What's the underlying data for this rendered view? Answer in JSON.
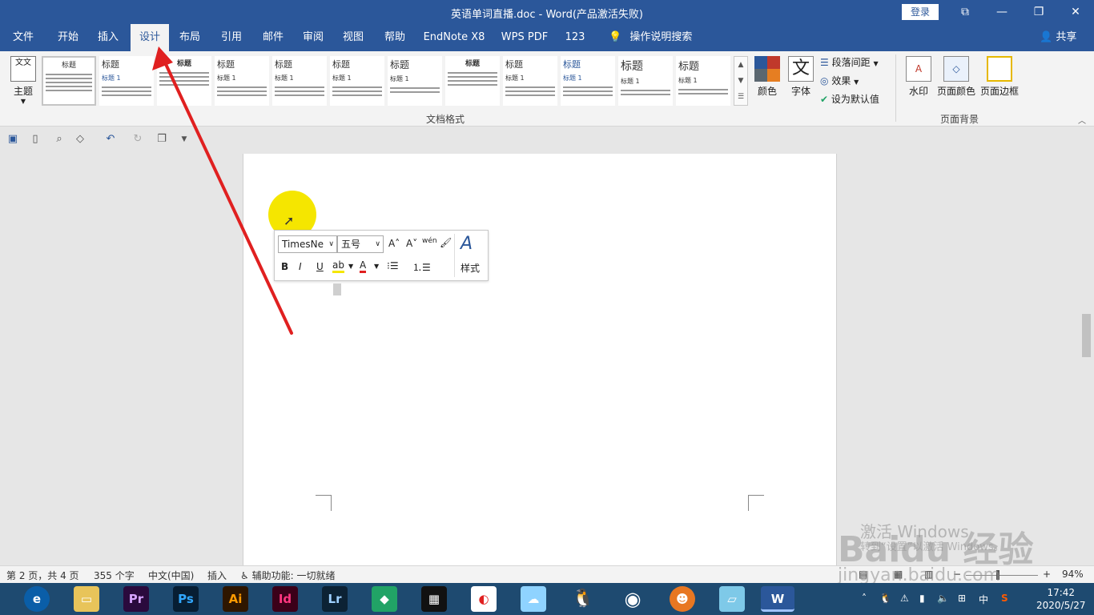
{
  "window": {
    "title": "英语单词直播.doc - Word(产品激活失败)",
    "login": "登录",
    "controls": [
      "⧉",
      "—",
      "❐",
      "✕"
    ]
  },
  "tabs": [
    "文件",
    "开始",
    "插入",
    "设计",
    "布局",
    "引用",
    "邮件",
    "审阅",
    "视图",
    "帮助",
    "EndNote X8",
    "WPS PDF",
    "123"
  ],
  "active_tab": "设计",
  "tell_me": "操作说明搜索",
  "share": "共享",
  "ribbon": {
    "theme_label": "主题",
    "theme_icon_text": "文文",
    "style_thumb_heading": "标题",
    "style_thumb_sub": "标题 1",
    "colors_label": "颜色",
    "fonts_label": "字体",
    "fonts_icon_text": "文",
    "paragraph_spacing": "段落间距",
    "effects": "效果",
    "set_default": "设为默认值",
    "watermark": "水印",
    "page_color": "页面颜色",
    "page_borders": "页面边框",
    "group_document_format": "文档格式",
    "group_page_background": "页面背景"
  },
  "mini_toolbar": {
    "font": "TimesNe",
    "size": "五号",
    "grow": "A˄",
    "shrink": "A˅",
    "phonetic": "wén",
    "bold": "B",
    "italic": "I",
    "underline": "U",
    "highlight": "ab",
    "font_color": "A",
    "styles": "样式"
  },
  "status": {
    "page": "第 2 页，共 4 页",
    "words": "355 个字",
    "language": "中文(中国)",
    "mode": "插入",
    "accessibility": "辅助功能: 一切就绪",
    "zoom": "94%"
  },
  "watermark": {
    "activate": "激活 Windows",
    "activate_sub": "转到“设置”以激活 Windows。",
    "brand": "Baidu 经验",
    "url": "jingyan.baidu.com"
  },
  "taskbar": {
    "apps": [
      "Pr",
      "Ps",
      "Ai",
      "Id",
      "Lr",
      "W"
    ],
    "ime": "中",
    "time": "17:42",
    "date": "2020/5/27"
  },
  "colors": {
    "accent": "#2b579a",
    "highlight_dot": "#f5e600",
    "arrow": "#e02020"
  }
}
